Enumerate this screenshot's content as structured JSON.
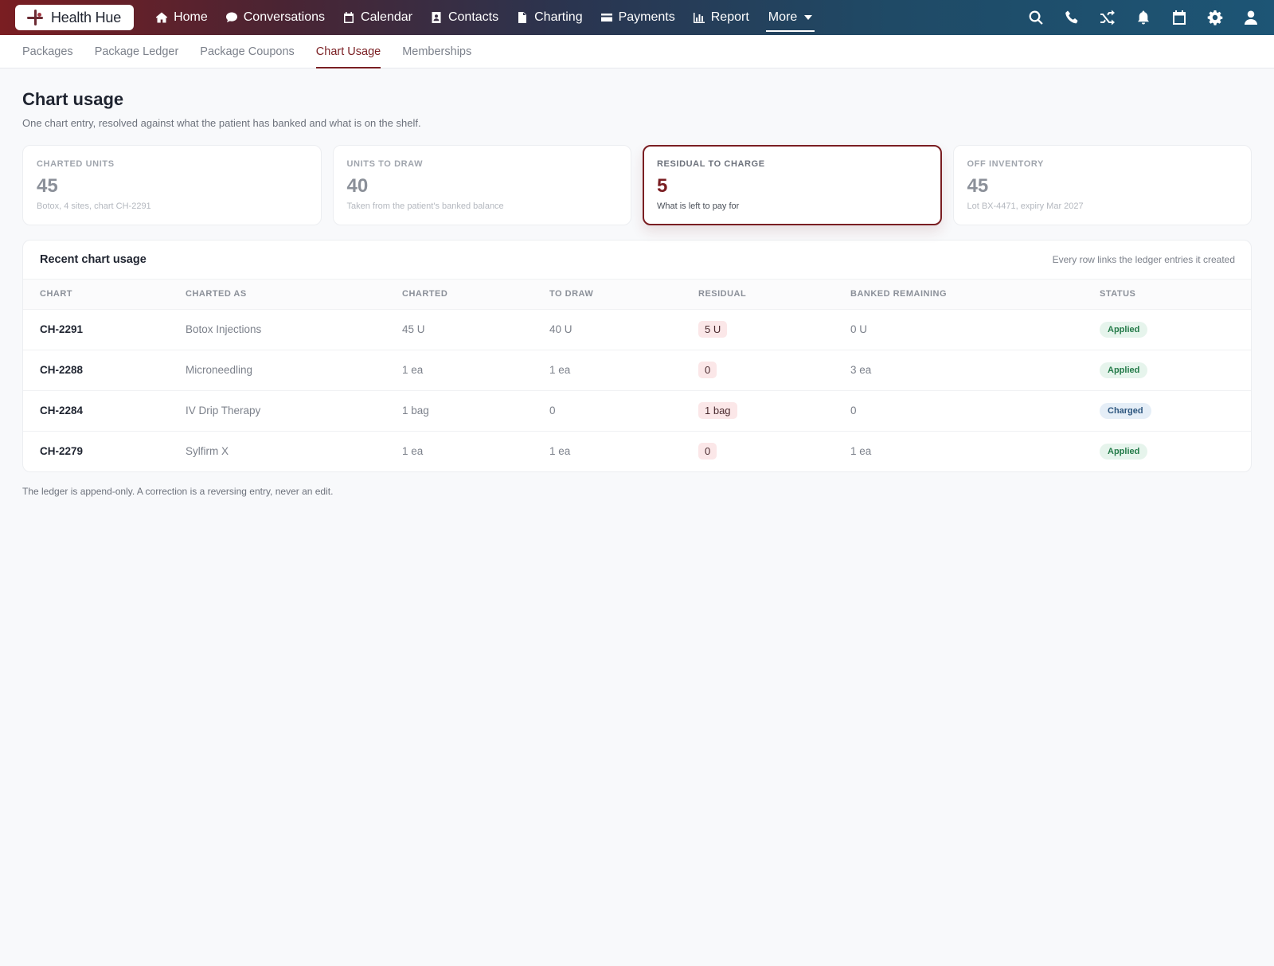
{
  "app": {
    "name": "Health Hue"
  },
  "nav": {
    "items": [
      {
        "label": "Home",
        "icon": "home-icon"
      },
      {
        "label": "Conversations",
        "icon": "chat-icon"
      },
      {
        "label": "Calendar",
        "icon": "calendar-icon"
      },
      {
        "label": "Contacts",
        "icon": "contact-card-icon"
      },
      {
        "label": "Charting",
        "icon": "document-icon"
      },
      {
        "label": "Payments",
        "icon": "credit-card-icon"
      },
      {
        "label": "Report",
        "icon": "bar-chart-icon"
      }
    ],
    "more_label": "More",
    "right_icons": [
      "search-icon",
      "phone-icon",
      "shuffle-icon",
      "bell-icon",
      "calendar-icon",
      "gear-icon",
      "user-icon"
    ]
  },
  "subtabs": [
    "Packages",
    "Package Ledger",
    "Package Coupons",
    "Chart Usage",
    "Memberships"
  ],
  "active_subtab": "Chart Usage",
  "page": {
    "title": "Chart usage",
    "subtitle": "One chart entry, resolved against what the patient has banked and what is on the shelf."
  },
  "cards": [
    {
      "label": "CHARTED UNITS",
      "value": "45",
      "note": "Botox, 4 sites, chart CH-2291"
    },
    {
      "label": "UNITS TO DRAW",
      "value": "40",
      "note": "Taken from the patient's banked balance"
    },
    {
      "label": "RESIDUAL TO CHARGE",
      "value": "5",
      "note": "What is left to pay for"
    },
    {
      "label": "OFF INVENTORY",
      "value": "45",
      "note": "Lot BX-4471, expiry Mar 2027"
    }
  ],
  "table": {
    "title": "Recent chart usage",
    "hint": "Every row links the ledger entries it created",
    "columns": [
      "CHART",
      "CHARTED AS",
      "CHARTED",
      "TO DRAW",
      "RESIDUAL",
      "BANKED REMAINING",
      "STATUS"
    ],
    "rows": [
      {
        "chart": "CH-2291",
        "charted_as": "Botox Injections",
        "charted": "45 U",
        "to_draw": "40 U",
        "residual": "5 U",
        "banked": "0 U",
        "status": "Applied"
      },
      {
        "chart": "CH-2288",
        "charted_as": "Microneedling",
        "charted": "1 ea",
        "to_draw": "1 ea",
        "residual": "0",
        "banked": "3 ea",
        "status": "Applied"
      },
      {
        "chart": "CH-2284",
        "charted_as": "IV Drip Therapy",
        "charted": "1 bag",
        "to_draw": "0",
        "residual": "1 bag",
        "banked": "0",
        "status": "Charged"
      },
      {
        "chart": "CH-2279",
        "charted_as": "Sylfirm X",
        "charted": "1 ea",
        "to_draw": "1 ea",
        "residual": "0",
        "banked": "1 ea",
        "status": "Applied"
      }
    ]
  },
  "footnote": "The ledger is append-only. A correction is a reversing entry, never an edit.",
  "colors": {
    "brand": "#7a1e22",
    "nav_end": "#1d5575",
    "applied": "#237a48",
    "charged": "#2c557e"
  }
}
